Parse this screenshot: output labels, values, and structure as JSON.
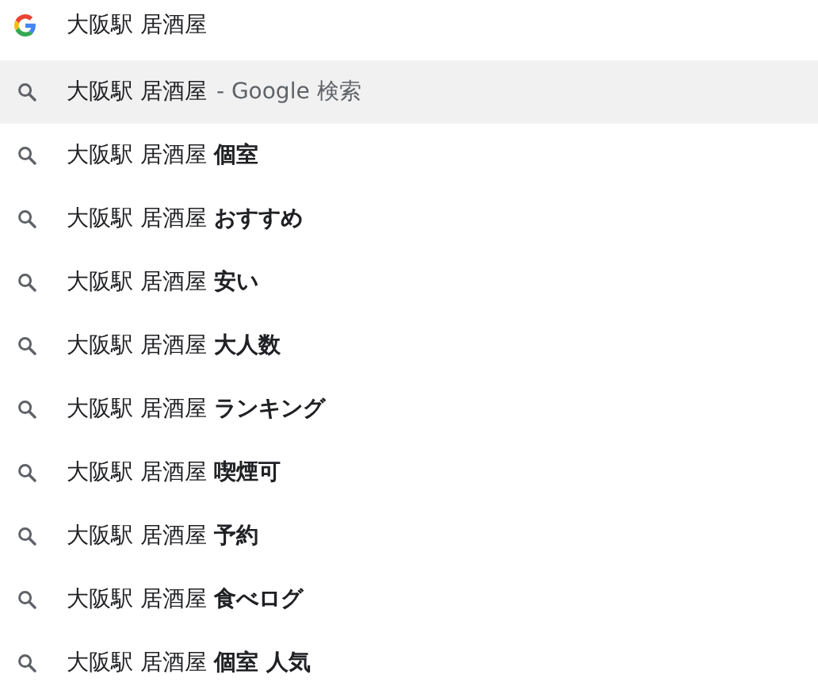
{
  "omnibox": {
    "value": "大阪駅 居酒屋"
  },
  "suggestions": [
    {
      "kind": "search",
      "text": "大阪駅 居酒屋",
      "hint": "- Google 検索",
      "selected": true
    },
    {
      "kind": "suggestion",
      "text": "大阪駅 居酒屋 **個室**",
      "selected": false
    },
    {
      "kind": "suggestion",
      "text": "大阪駅 居酒屋 **おすすめ**",
      "selected": false
    },
    {
      "kind": "suggestion",
      "text": "大阪駅 居酒屋 **安い**",
      "selected": false
    },
    {
      "kind": "suggestion",
      "text": "大阪駅 居酒屋 **大人数**",
      "selected": false
    },
    {
      "kind": "suggestion",
      "text": "大阪駅 居酒屋 **ランキング**",
      "selected": false
    },
    {
      "kind": "suggestion",
      "text": "大阪駅 居酒屋 **喫煙可**",
      "selected": false
    },
    {
      "kind": "suggestion",
      "text": "大阪駅 居酒屋 **予約**",
      "selected": false
    },
    {
      "kind": "suggestion",
      "text": "大阪駅 居酒屋 **食べログ**",
      "selected": false
    },
    {
      "kind": "suggestion",
      "text": "大阪駅 居酒屋 **個室 人気**",
      "selected": false
    }
  ]
}
